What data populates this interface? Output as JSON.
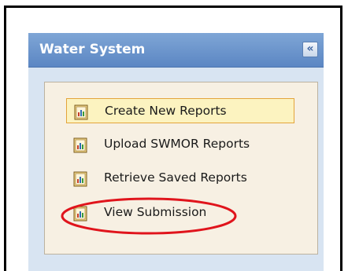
{
  "panel": {
    "title": "Water System",
    "collapse_glyph": "«"
  },
  "menu": {
    "items": [
      {
        "label": "Create New Reports",
        "icon": "report-icon",
        "selected": true
      },
      {
        "label": "Upload SWMOR Reports",
        "icon": "report-icon",
        "selected": false
      },
      {
        "label": "Retrieve Saved Reports",
        "icon": "report-icon",
        "selected": false
      },
      {
        "label": "View Submission",
        "icon": "report-icon",
        "selected": false,
        "annotated": true
      }
    ]
  },
  "colors": {
    "header": "#6b93cc",
    "selected_bg": "#fcf3c0",
    "selected_border": "#e3a43a",
    "annotation": "#e0141c"
  }
}
